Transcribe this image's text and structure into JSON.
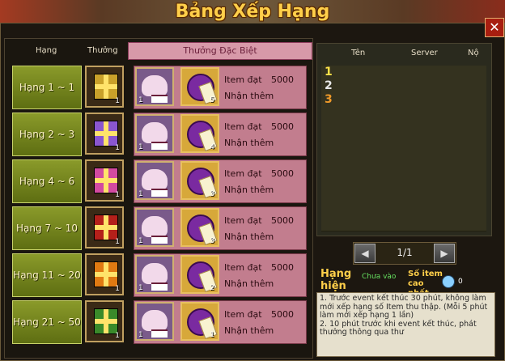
{
  "window": {
    "title": "Bảng Xếp Hạng",
    "close_label": "✕"
  },
  "left": {
    "header_rank": "Hạng",
    "header_reward": "Thưởng",
    "header_special": "Thưởng Đặc Biệt",
    "rows": [
      {
        "rank": "Hạng 1 ~ 1",
        "gift_color": "#c9a12a",
        "gift_count": "1",
        "monster_count": "1",
        "scroll_count": "5",
        "item_label": "Item đạt",
        "item_value": "5000",
        "bonus_label": "Nhận thêm"
      },
      {
        "rank": "Hạng 2 ~ 3",
        "gift_color": "#8a56d0",
        "gift_count": "1",
        "monster_count": "1",
        "scroll_count": "4",
        "item_label": "Item đạt",
        "item_value": "5000",
        "bonus_label": "Nhận thêm"
      },
      {
        "rank": "Hạng 4 ~ 6",
        "gift_color": "#d24aa0",
        "gift_count": "1",
        "monster_count": "1",
        "scroll_count": "3",
        "item_label": "Item đạt",
        "item_value": "5000",
        "bonus_label": "Nhận thêm"
      },
      {
        "rank": "Hạng 7 ~ 10",
        "gift_color": "#b4201a",
        "gift_count": "1",
        "monster_count": "1",
        "scroll_count": "3",
        "item_label": "Item đạt",
        "item_value": "5000",
        "bonus_label": "Nhận thêm"
      },
      {
        "rank": "Hạng 11 ~ 20",
        "gift_color": "#e07a12",
        "gift_count": "1",
        "monster_count": "1",
        "scroll_count": "2",
        "item_label": "Item đạt",
        "item_value": "5000",
        "bonus_label": "Nhận thêm"
      },
      {
        "rank": "Hạng 21 ~ 50",
        "gift_color": "#3a8a2a",
        "gift_count": "1",
        "monster_count": "1",
        "scroll_count": "1",
        "item_label": "Item đạt",
        "item_value": "5000",
        "bonus_label": "Nhận thêm"
      }
    ]
  },
  "right": {
    "header_name": "Tên",
    "header_server": "Server",
    "header_extra": "Nộ",
    "rankings": [
      {
        "num": "1",
        "color": "#ffe24a"
      },
      {
        "num": "2",
        "color": "#e8e8e8"
      },
      {
        "num": "3",
        "color": "#f09a2a"
      }
    ],
    "pager": {
      "prev": "◀",
      "text": "1/1",
      "next": "▶"
    },
    "current_rank_label": "Hạng hiện tại",
    "current_rank_value": "Chưa vào",
    "best_label": "Số item cao nhất",
    "best_value": "0",
    "notes": [
      "1. Trước event kết thúc 30 phút, không làm mới xếp hạng số Item thu thập. (Mỗi 5 phút làm mới xếp hạng 1 lần)",
      "2. 10 phút trước khi event kết thúc, phát thưởng thông qua thư"
    ]
  }
}
